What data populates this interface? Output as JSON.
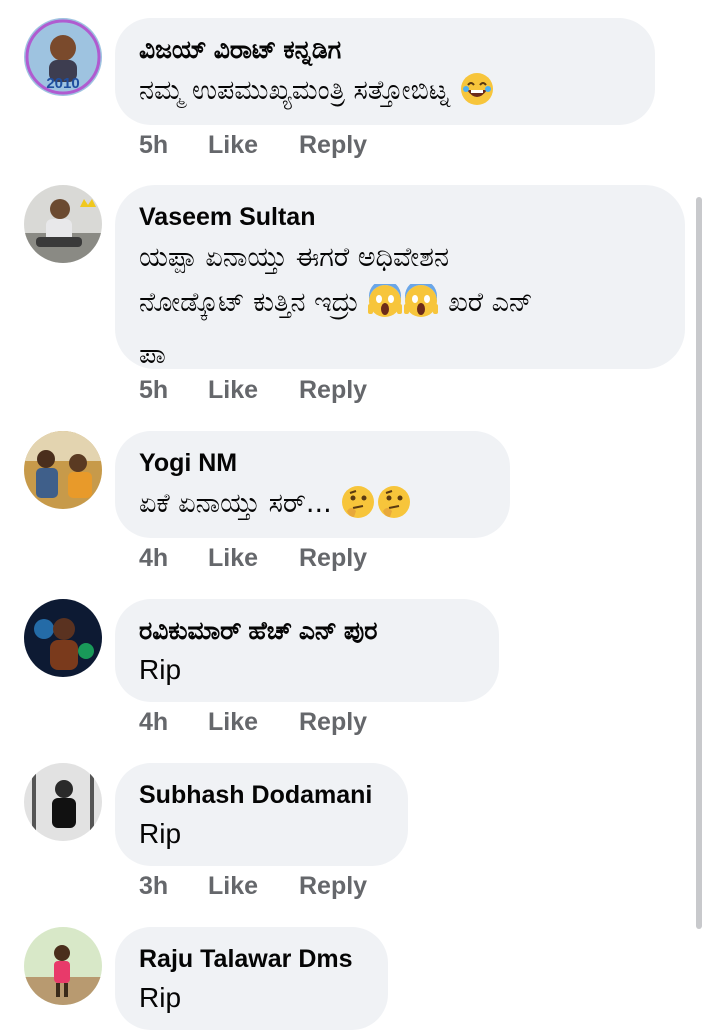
{
  "comments": [
    {
      "author": "ವಿಜಯ್ ವಿರಾಟ್ ಕನ್ನಡಿಗ",
      "text": "ನಮ್ಮ ಉಪಮುಖ್ಯಮಂತ್ರಿ ಸತ್ತೋಬಿಟ್ನ",
      "emoji": "😂",
      "time": "5h",
      "like": "Like",
      "reply": "Reply",
      "avatar_caption": "2010"
    },
    {
      "author": "Vaseem Sultan",
      "text_line1": "ಯಪ್ಪಾ ಏನಾಯ್ತು ಈಗರೆ ಅಧಿವೇಶನ",
      "text_line2a": "ನೋಡ್ಕೊಟ್ ಕುತ್ತಿನ ಇದ್ರು",
      "emoji": "😱",
      "text_line2b": "ಖರೆ ಎನ್",
      "text_line3": "ಪಾ",
      "time": "5h",
      "like": "Like",
      "reply": "Reply"
    },
    {
      "author": "Yogi NM",
      "text": "ಏಕೆ ಏನಾಯ್ತು ಸರ್...",
      "emoji": "🤔",
      "time": "4h",
      "like": "Like",
      "reply": "Reply"
    },
    {
      "author": "ರವಿಕುಮಾರ್ ಹೆಚ್ ಎನ್ ಪುರ",
      "text": "Rip",
      "time": "4h",
      "like": "Like",
      "reply": "Reply"
    },
    {
      "author": "Subhash Dodamani",
      "text": "Rip",
      "time": "3h",
      "like": "Like",
      "reply": "Reply"
    },
    {
      "author": "Raju Talawar Dms",
      "text": "Rip"
    }
  ],
  "colors": {
    "bubble": "#f0f2f5",
    "meta_text": "#65676b",
    "author_text": "#050505",
    "scrollbar": "#c8c9cc"
  }
}
